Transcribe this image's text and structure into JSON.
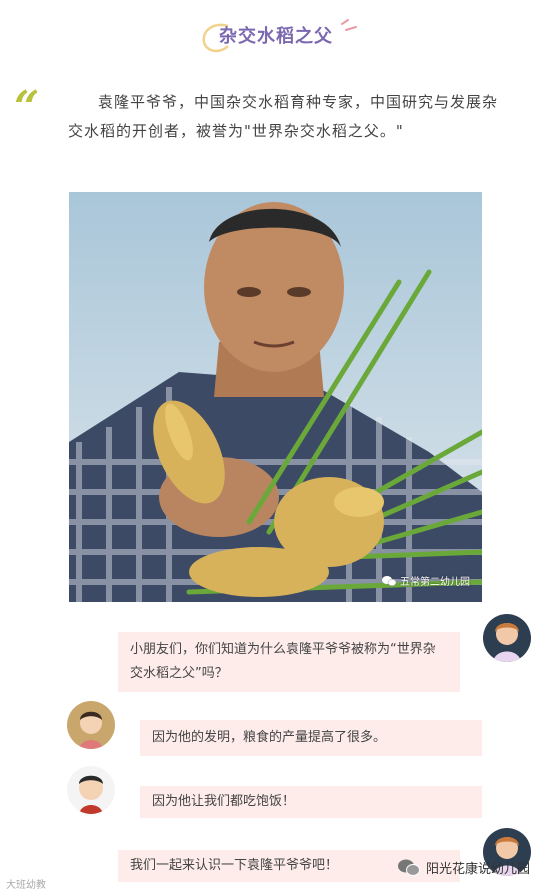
{
  "header": {
    "title": "杂交水稻之父"
  },
  "intro": {
    "quote_mark": "“",
    "text": "袁隆平爷爷，中国杂交水稻育种专家，中国研究与发展杂交水稻的开创者，被誉为\"世界杂交水稻之父。\""
  },
  "photo": {
    "watermark": "五常第二幼儿园"
  },
  "chat": [
    {
      "text": "小朋友们，你们知道为什么袁隆平爷爷被称为“世界杂交水稻之父”吗？"
    },
    {
      "text": "因为他的发明，粮食的产量提高了很多。"
    },
    {
      "text": "因为他让我们都吃饱饭！"
    },
    {
      "text": "我们一起来认识一下袁隆平爷爷吧！"
    }
  ],
  "footer": {
    "account": "阳光花康说幼儿园",
    "source": "大班幼教"
  },
  "colors": {
    "title": "#7b68b0",
    "quote": "#b9c13d",
    "bubble": "#fdecea"
  }
}
